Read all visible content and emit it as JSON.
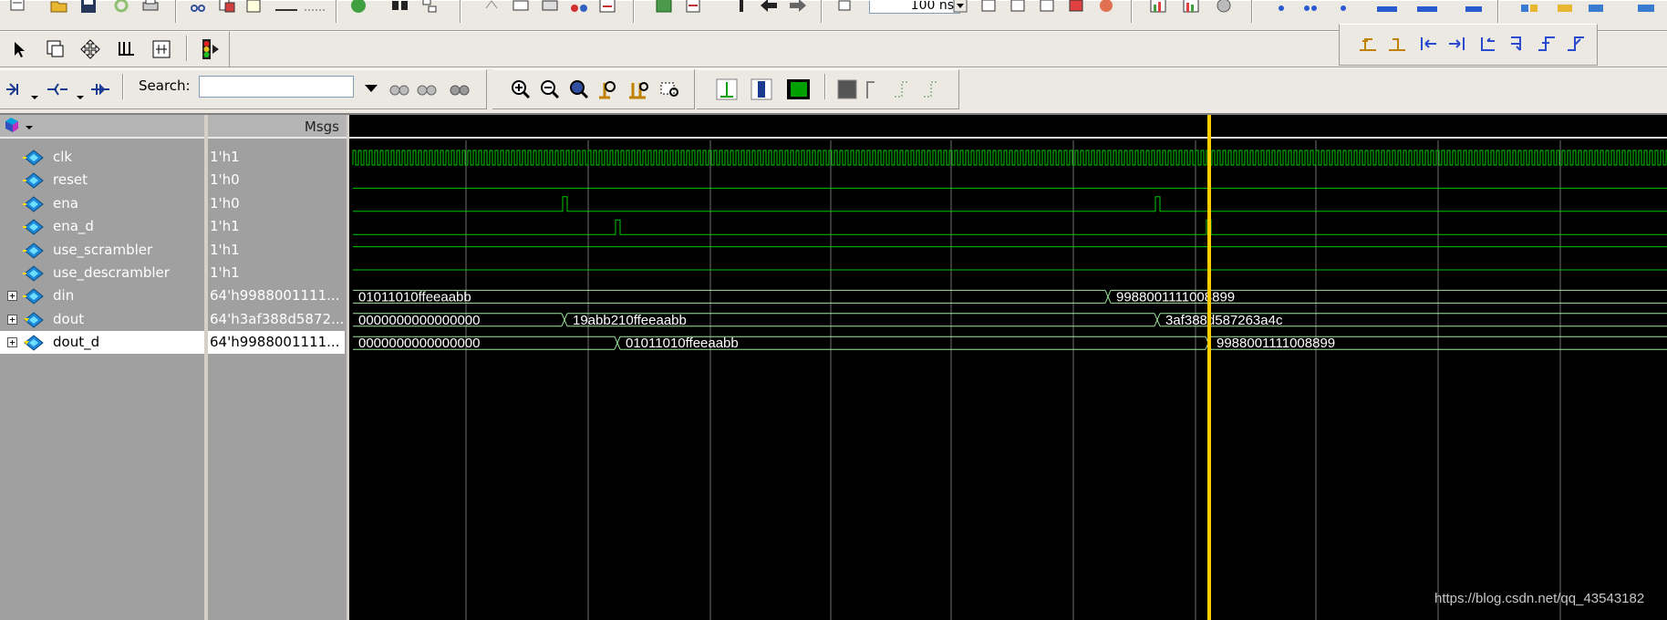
{
  "toolbar": {
    "search_label": "Search:",
    "search_value": "",
    "zoom_value": "100 ns"
  },
  "panes": {
    "msgs_title": "Msgs"
  },
  "signals": [
    {
      "name": "clk",
      "value": "1'h1",
      "expandable": false
    },
    {
      "name": "reset",
      "value": "1'h0",
      "expandable": false
    },
    {
      "name": "ena",
      "value": "1'h0",
      "expandable": false
    },
    {
      "name": "ena_d",
      "value": "1'h1",
      "expandable": false
    },
    {
      "name": "use_scrambler",
      "value": "1'h1",
      "expandable": false
    },
    {
      "name": "use_descrambler",
      "value": "1'h1",
      "expandable": false
    },
    {
      "name": "din",
      "value": "64'h9988001111...",
      "expandable": true
    },
    {
      "name": "dout",
      "value": "64'h3af388d5872...",
      "expandable": true
    },
    {
      "name": "dout_d",
      "value": "64'h9988001111...",
      "expandable": true,
      "selected": true
    }
  ],
  "bus_values": {
    "din": [
      "01011010ffeeaabb",
      "9988001111008899"
    ],
    "dout": [
      "0000000000000000",
      "19abb210ffeeaabb",
      "3af388d587263a4c"
    ],
    "dout_d": [
      "0000000000000000",
      "01011010ffeeaabb",
      "9988001111008899"
    ]
  },
  "watermark": "https://blog.csdn.net/qq_43543182",
  "colors": {
    "wave": "#00c800",
    "bus": "#9ee89e",
    "cursor": "#ffcc00",
    "grid": "#707070",
    "pane_bg": "#a0a0a0",
    "wave_bg": "#000000"
  }
}
